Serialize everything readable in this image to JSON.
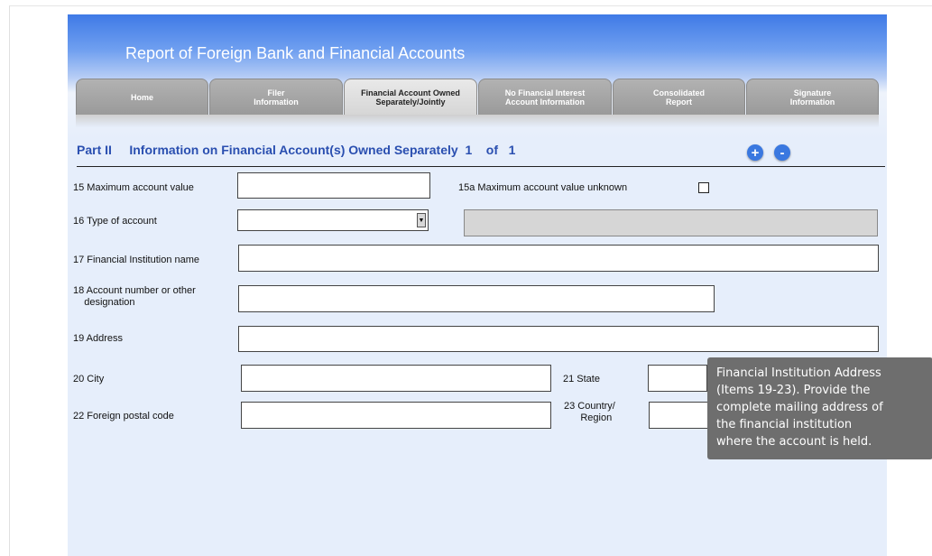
{
  "header": {
    "title": "Report of Foreign Bank and Financial Accounts"
  },
  "tabs": [
    {
      "label": "Home"
    },
    {
      "label": "Filer\nInformation"
    },
    {
      "label": "Financial Account Owned\nSeparately/Jointly"
    },
    {
      "label": "No Financial Interest\nAccount Information"
    },
    {
      "label": "Consolidated\nReport"
    },
    {
      "label": "Signature\nInformation"
    }
  ],
  "part": {
    "title": "Part II     Information on Financial Account(s) Owned Separately  1    of   1",
    "add_label": "+",
    "remove_label": "-"
  },
  "fields": {
    "max_value": {
      "label": "15 Maximum account value",
      "value": ""
    },
    "max_unknown": {
      "label": "15a Maximum account value unknown",
      "checked": false
    },
    "type": {
      "label": "16 Type of account",
      "value": ""
    },
    "institution": {
      "label": "17 Financial Institution name",
      "value": ""
    },
    "account_number": {
      "label": "18 Account number or other\n    designation",
      "value": ""
    },
    "address": {
      "label": "19  Address",
      "value": ""
    },
    "city": {
      "label": "20  City",
      "value": ""
    },
    "state": {
      "label": "21 State",
      "value": ""
    },
    "postal": {
      "label": "22 Foreign postal code",
      "value": ""
    },
    "country": {
      "label": "23 Country/\n      Region",
      "value": ""
    }
  },
  "tooltip": {
    "text": "Financial Institution Address\n(Items 19-23). Provide the\ncomplete mailing address of\nthe financial institution\nwhere the account is held."
  },
  "colors": {
    "accent": "#2a4fb0",
    "form_bg": "#e6eefb",
    "tooltip_bg": "#6e6e6e"
  }
}
